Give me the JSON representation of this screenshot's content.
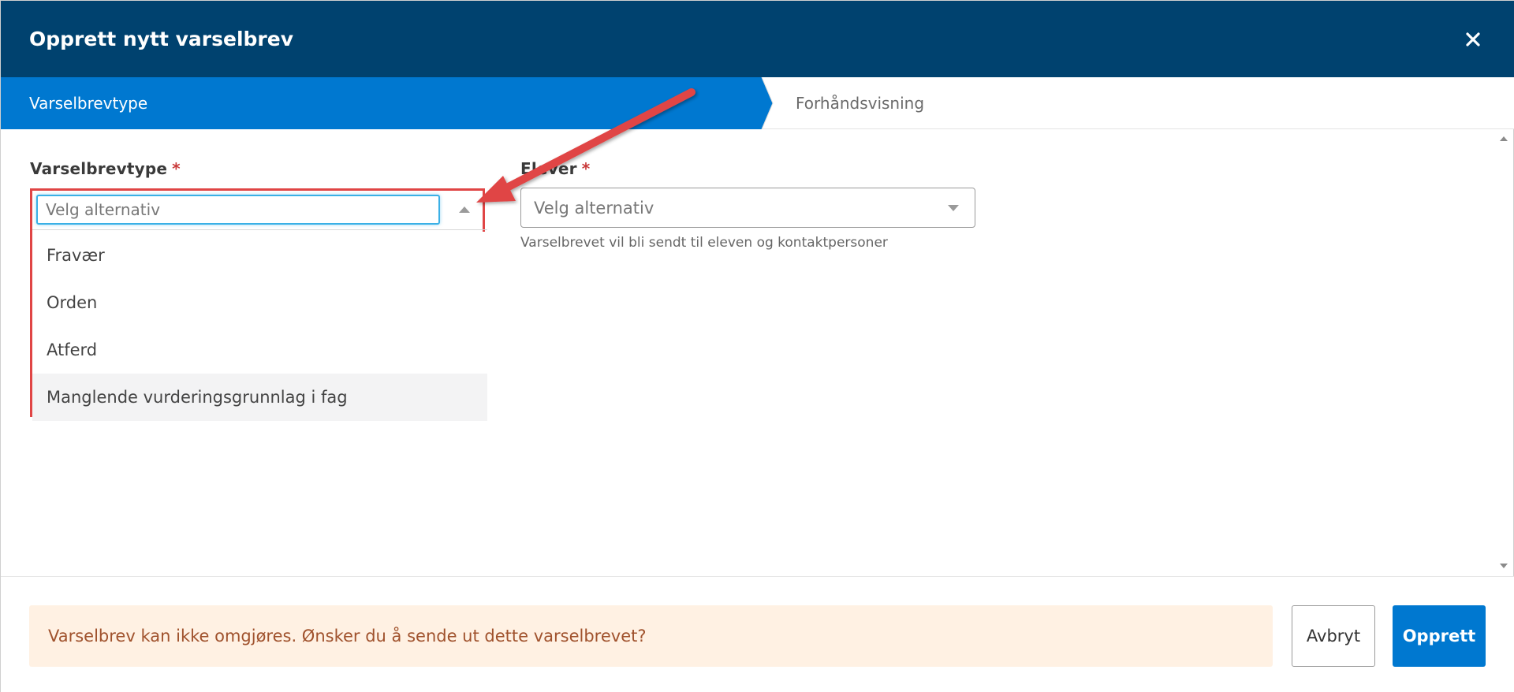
{
  "dialog": {
    "title": "Opprett nytt varselbrev",
    "close_icon": "close-icon"
  },
  "steps": [
    {
      "label": "Varselbrevtype",
      "active": true
    },
    {
      "label": "Forhåndsvisning",
      "active": false
    }
  ],
  "fields": {
    "varselbrevtype": {
      "label": "Varselbrevtype",
      "required_marker": "*",
      "placeholder": "Velg alternativ",
      "value": "",
      "open": true,
      "options": [
        "Fravær",
        "Orden",
        "Atferd",
        "Manglende vurderingsgrunnlag i fag"
      ],
      "hovered_option": "Manglende vurderingsgrunnlag i fag"
    },
    "elever": {
      "label": "Elever",
      "required_marker": "*",
      "placeholder": "Velg alternativ",
      "helper_text": "Varselbrevet vil bli sendt til eleven og kontaktpersoner"
    }
  },
  "footer": {
    "warning_text": "Varselbrev kan ikke omgjøres. Ønsker du å sende ut dette varselbrevet?",
    "cancel_label": "Avbryt",
    "create_label": "Opprett"
  },
  "colors": {
    "header_bg": "#00426f",
    "step_active_bg": "#0078d0",
    "primary_button": "#0078d0",
    "required": "#c93a3a",
    "warning_bg": "#fff1e3",
    "warning_text": "#a0522d",
    "annotation": "#e04545"
  }
}
